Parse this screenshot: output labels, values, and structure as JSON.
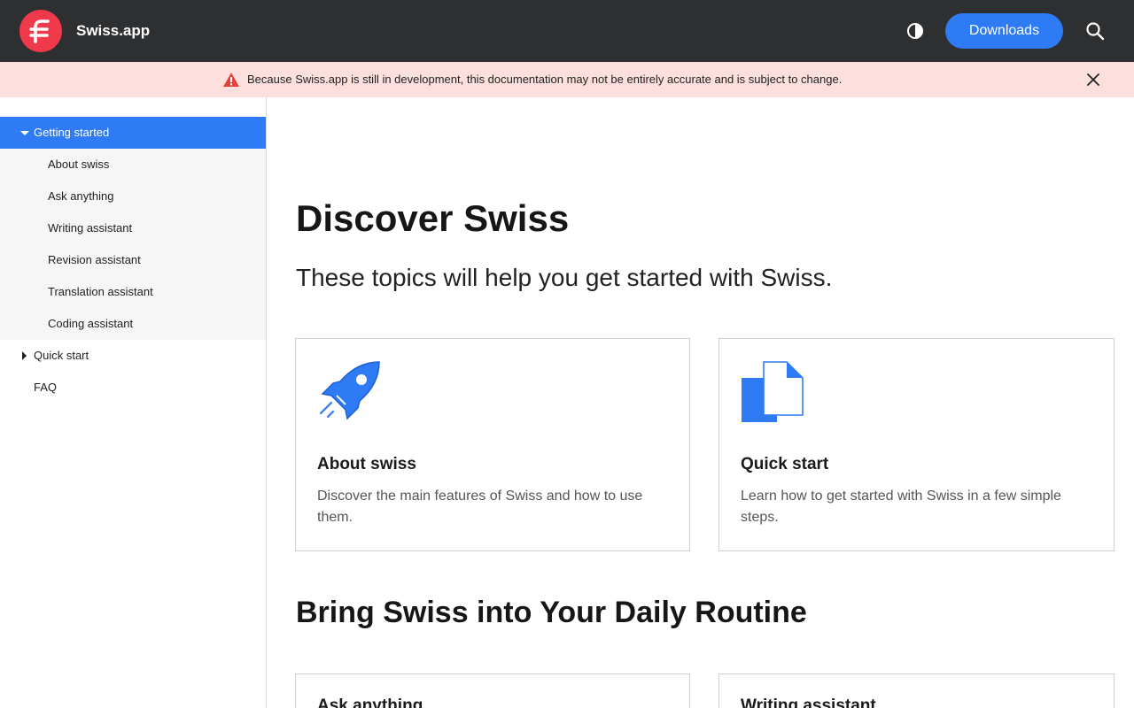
{
  "header": {
    "brand": "Swiss.app",
    "downloads_label": "Downloads",
    "logo_icon": "swiss-logo-icon",
    "theme_icon": "contrast-icon",
    "search_icon": "search-icon"
  },
  "banner": {
    "text": "Because Swiss.app is still in development, this documentation may not be entirely accurate and is subject to change.",
    "warning_icon": "warning-icon",
    "close_icon": "close-icon"
  },
  "sidebar": {
    "getting_started": "Getting started",
    "sub_items": [
      "About swiss",
      "Ask anything",
      "Writing assistant",
      "Revision assistant",
      "Translation assistant",
      "Coding assistant"
    ],
    "quick_start": "Quick start",
    "faq": "FAQ"
  },
  "main": {
    "title": "Discover Swiss",
    "lead": "These topics will help you get started with Swiss.",
    "cards": [
      {
        "title": "About swiss",
        "description": "Discover the main features of Swiss and how to use them.",
        "icon": "rocket-icon"
      },
      {
        "title": "Quick start",
        "description": "Learn how to get started with Swiss in a few simple steps.",
        "icon": "documents-icon"
      }
    ],
    "section2_title": "Bring Swiss into Your Daily Routine",
    "section2_cards": [
      "Ask anything",
      "Writing assistant"
    ]
  },
  "colors": {
    "accent": "#2f7bf5",
    "topbar": "#2e2f31",
    "logo": "#f0394a",
    "banner_bg": "#fde0dd",
    "warning": "#e0443a"
  }
}
